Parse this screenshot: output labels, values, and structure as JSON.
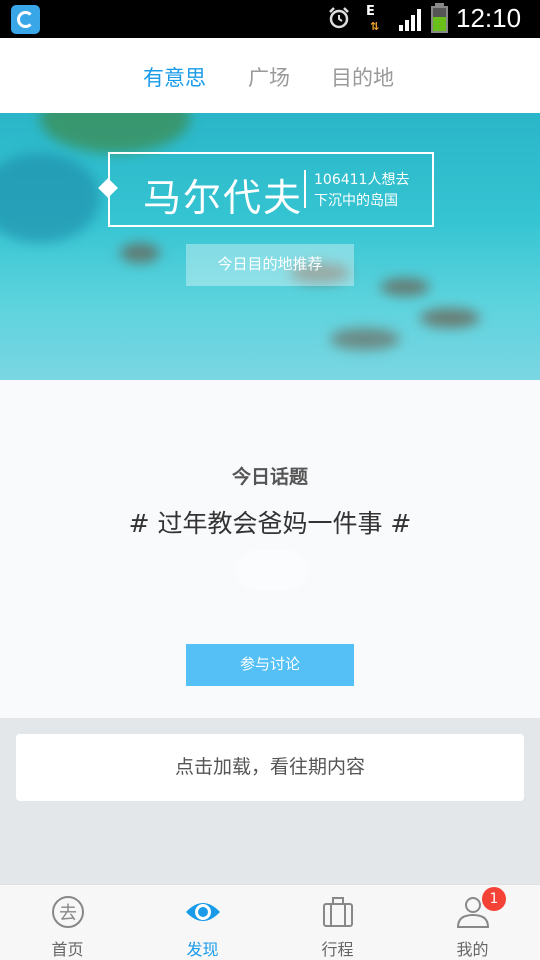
{
  "status_bar": {
    "time": "12:10",
    "network_type": "E"
  },
  "top_tabs": [
    {
      "label": "有意思",
      "active": true
    },
    {
      "label": "广场",
      "active": false
    },
    {
      "label": "目的地",
      "active": false
    }
  ],
  "hero": {
    "title": "马尔代夫",
    "subtitle_count": "106411人想去",
    "subtitle_desc": "下沉中的岛国",
    "button_label": "今日目的地推荐"
  },
  "topic": {
    "label": "今日话题",
    "title": "# 过年教会爸妈一件事 #",
    "button_label": "参与讨论"
  },
  "load_more": {
    "label": "点击加载，看往期内容"
  },
  "bottom_nav": [
    {
      "label": "首页",
      "icon": "home-qu-icon",
      "active": false
    },
    {
      "label": "发现",
      "icon": "eye-icon",
      "active": true
    },
    {
      "label": "行程",
      "icon": "suitcase-icon",
      "active": false
    },
    {
      "label": "我的",
      "icon": "user-icon",
      "active": false,
      "badge": "1"
    }
  ],
  "colors": {
    "accent": "#1a9bea",
    "button_blue": "#54c0f6",
    "badge_red": "#f44336"
  }
}
